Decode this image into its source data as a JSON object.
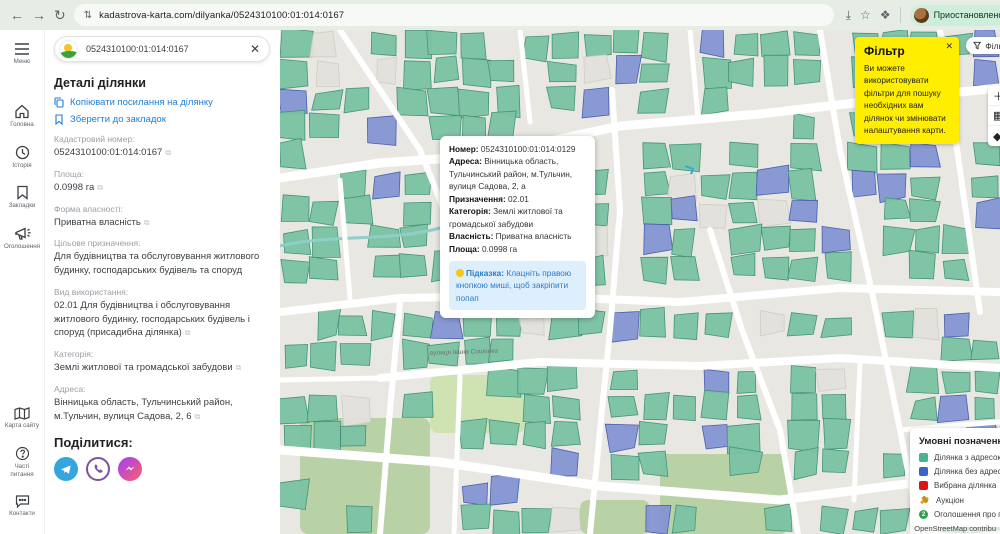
{
  "browser": {
    "url": "kadastrova-karta.com/dilyanka/0524310100:01:014:0167",
    "paused_label": "Приостановлено"
  },
  "sidebar": {
    "items": [
      {
        "label": "Меню"
      },
      {
        "label": "Головна"
      },
      {
        "label": "Історія"
      },
      {
        "label": "Закладки"
      },
      {
        "label": "Оголошення"
      }
    ],
    "bottom_items": [
      {
        "label": "Карта сайту"
      },
      {
        "label": "Часті питання"
      },
      {
        "label": "Контакти"
      }
    ]
  },
  "panel": {
    "search_value": "0524310100:01:014:0167",
    "title": "Деталі ділянки",
    "link_copy": "Копіювати посилання на ділянку",
    "link_bookmark": "Зберегти до закладок",
    "fields": [
      {
        "label": "Кадастровий номер:",
        "value": "0524310100:01:014:0167"
      },
      {
        "label": "Площа:",
        "value": "0.0998 га"
      },
      {
        "label": "Форма власності:",
        "value": "Приватна власність"
      },
      {
        "label": "Цільове призначення:",
        "value": "Для будівництва та обслуговування житлового будинку, господарських будівель та споруд"
      },
      {
        "label": "Вид використання:",
        "value": "02.01 Для будівництва і обслуговування житлового будинку, господарських будівель і споруд (присадибна ділянка)"
      },
      {
        "label": "Категорія:",
        "value": "Землі житлової та громадської забудови"
      },
      {
        "label": "Адреса:",
        "value": "Вінницька область, Тульчинський район, м.Тульчин, вулиця Садова, 2, 6"
      }
    ],
    "share_title": "Поділитися:"
  },
  "map": {
    "street_label": "вулиця Івана Сошенка",
    "popup": {
      "rows": [
        {
          "label": "Номер:",
          "value": "0524310100:01:014:0129"
        },
        {
          "label": "Адреса:",
          "value": "Вінницька область, Тульчинський район, м.Тульчин, вулиця Садова, 2, а"
        },
        {
          "label": "Призначення:",
          "value": "02.01"
        },
        {
          "label": "Категорія:",
          "value": "Землі житлової та громадської забудови"
        },
        {
          "label": "Власність:",
          "value": "Приватна власність"
        },
        {
          "label": "Площа:",
          "value": "0.0998 га"
        }
      ],
      "hint_label": "Підказка:",
      "hint_text": "Клацніть правою кнопкою миші, щоб закріпити попап"
    },
    "filter_tooltip": {
      "title": "Фільтр",
      "text": "Ви можете використовувати фільтри для пошуку необхідних вам ділянок чи змінювати налаштування карти."
    },
    "filter_button": "Фільтр",
    "legend": {
      "title": "Умовні позначення",
      "items": [
        {
          "label": "Ділянка з адресою",
          "color": "#46b48e"
        },
        {
          "label": "Ділянка без адреси",
          "color": "#3c64c8"
        },
        {
          "label": "Вибрана ділянка",
          "color": "#e01313"
        },
        {
          "label": "Аукціон",
          "color": "#e0a62c"
        },
        {
          "label": "Оголошення про продаж",
          "color": "#2aa24a",
          "badge": "2"
        }
      ]
    },
    "attribution": "OpenStreetMap contribu"
  },
  "colors": {
    "parcel_green": "#7ac2a2",
    "parcel_green_stroke": "#45937a",
    "parcel_blue": "#8495d2",
    "parcel_blue_stroke": "#4a5fae",
    "selected_red": "#e0251c",
    "accent_link": "#1f7fd4",
    "filter_yellow": "#ffee00"
  }
}
